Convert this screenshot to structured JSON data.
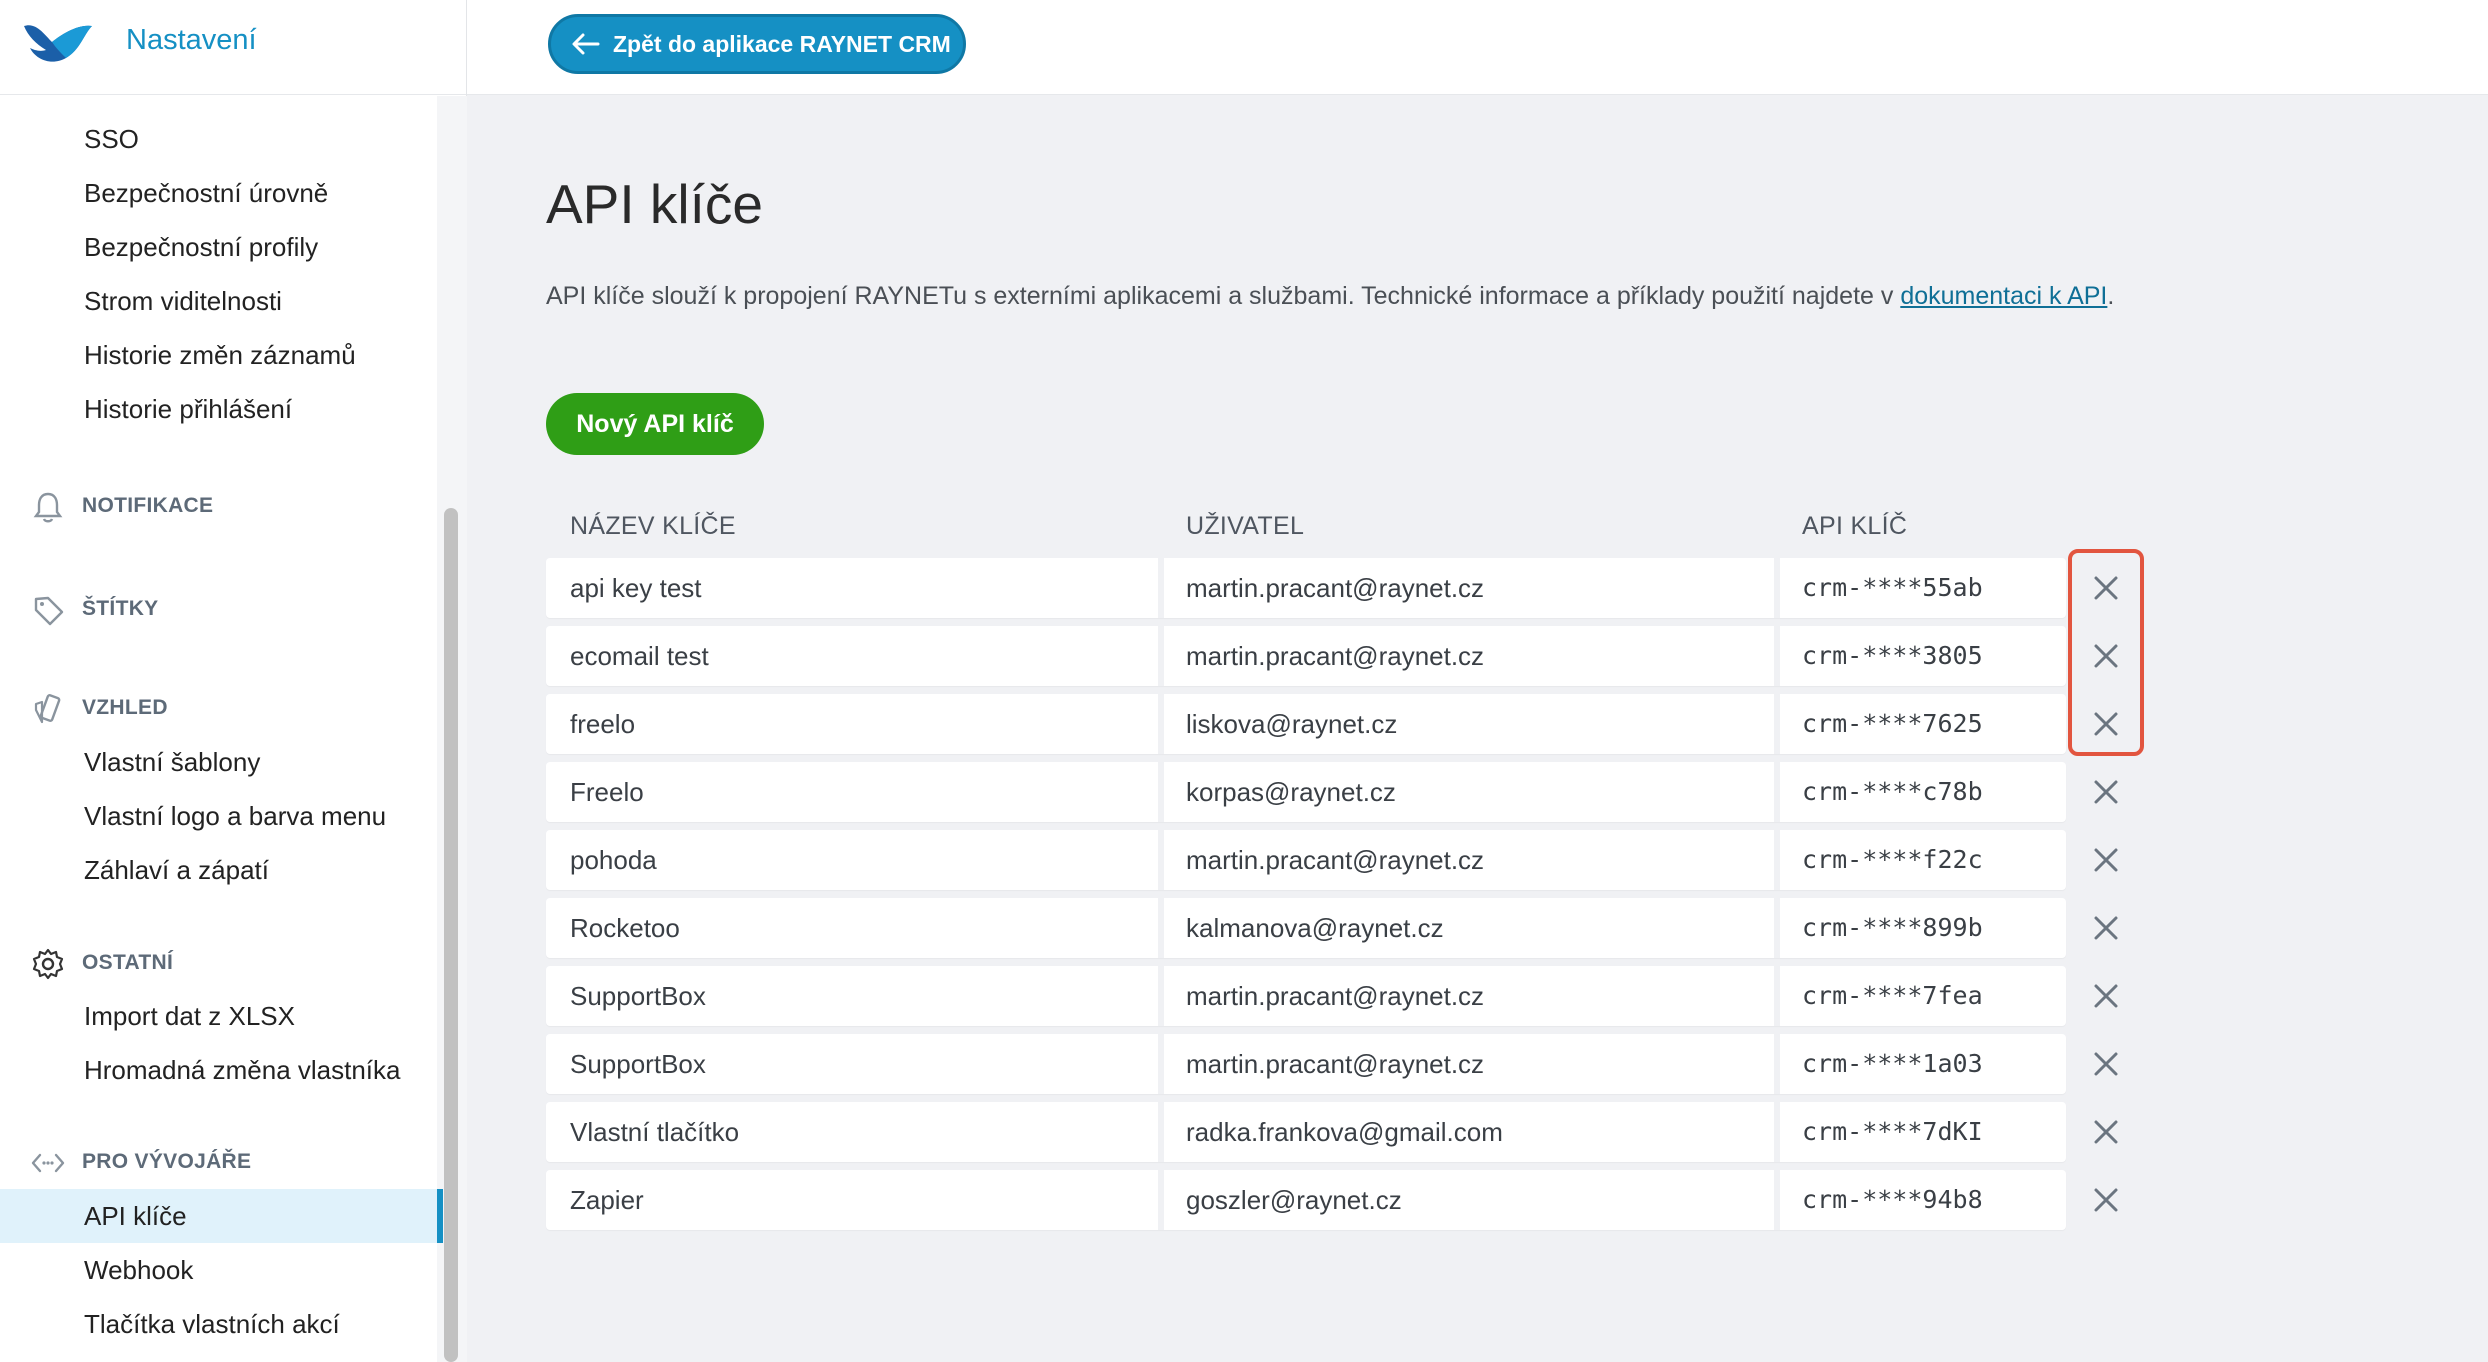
{
  "app": {
    "title": "Nastavení"
  },
  "topbar": {
    "back_label": "Zpět do aplikace RAYNET CRM"
  },
  "sidebar": {
    "security_items": [
      "SSO",
      "Bezpečnostní úrovně",
      "Bezpečnostní profily",
      "Strom viditelnosti",
      "Historie změn záznamů",
      "Historie přihlášení"
    ],
    "sections": {
      "notifikace": "NOTIFIKACE",
      "stitky": "ŠTÍTKY",
      "vzhled": "VZHLED",
      "ostatni": "OSTATNÍ",
      "pro_vyvojare": "PRO VÝVOJÁŘE"
    },
    "vzhled_items": [
      "Vlastní šablony",
      "Vlastní logo a barva menu",
      "Záhlaví a zápatí"
    ],
    "ostatni_items": [
      "Import dat z XLSX",
      "Hromadná změna vlastníka"
    ],
    "dev_items": [
      "API klíče",
      "Webhook",
      "Tlačítka vlastních akcí"
    ],
    "active_item": "API klíče"
  },
  "main": {
    "title": "API klíče",
    "description_prefix": "API klíče slouží k propojení RAYNETu s externími aplikacemi a službami. Technické informace a příklady použití najdete v ",
    "description_link": "dokumentaci k API",
    "description_suffix": ".",
    "new_key_label": "Nový API klíč",
    "columns": [
      "NÁZEV KLÍČE",
      "UŽIVATEL",
      "API KLÍČ"
    ],
    "rows": [
      {
        "name": "api key test",
        "user": "martin.pracant@raynet.cz",
        "key": "crm-****55ab"
      },
      {
        "name": "ecomail test",
        "user": "martin.pracant@raynet.cz",
        "key": "crm-****3805"
      },
      {
        "name": "freelo",
        "user": "liskova@raynet.cz",
        "key": "crm-****7625"
      },
      {
        "name": "Freelo",
        "user": "korpas@raynet.cz",
        "key": "crm-****c78b"
      },
      {
        "name": "pohoda",
        "user": "martin.pracant@raynet.cz",
        "key": "crm-****f22c"
      },
      {
        "name": "Rocketoo",
        "user": "kalmanova@raynet.cz",
        "key": "crm-****899b"
      },
      {
        "name": "SupportBox",
        "user": "martin.pracant@raynet.cz",
        "key": "crm-****7fea"
      },
      {
        "name": "SupportBox",
        "user": "martin.pracant@raynet.cz",
        "key": "crm-****1a03"
      },
      {
        "name": "Vlastní tlačítko",
        "user": "radka.frankova@gmail.com",
        "key": "crm-****7dKI"
      },
      {
        "name": "Zapier",
        "user": "goszler@raynet.cz",
        "key": "crm-****94b8"
      }
    ]
  },
  "colors": {
    "accent": "#1590c4",
    "primary_button": "#2f9e16",
    "highlight": "#e2553f"
  }
}
